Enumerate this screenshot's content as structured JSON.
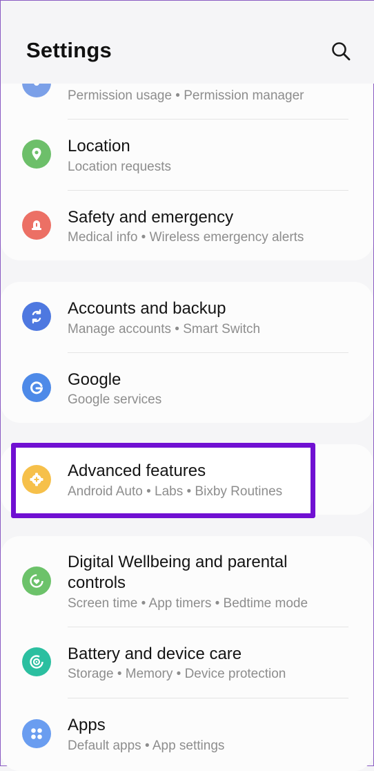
{
  "header": {
    "title": "Settings"
  },
  "colors": {
    "highlight": "#7010d2",
    "privacy": "#7ba0e8",
    "location": "#6dbf6a",
    "safety": "#ec7065",
    "accounts": "#4e78e0",
    "google": "#4e8ae8",
    "advanced": "#f6c04a",
    "wellbeing": "#6cc26a",
    "battery": "#2bbfa0",
    "apps": "#6a9df0"
  },
  "rows": {
    "privacy": {
      "subtitle": "Permission usage  •  Permission manager",
      "icon": "shield-icon"
    },
    "location": {
      "title": "Location",
      "subtitle": "Location requests",
      "icon": "location-pin-icon"
    },
    "safety": {
      "title": "Safety and emergency",
      "subtitle": "Medical info  •  Wireless emergency alerts",
      "icon": "siren-icon"
    },
    "accounts": {
      "title": "Accounts and backup",
      "subtitle": "Manage accounts  •  Smart Switch",
      "icon": "sync-icon"
    },
    "google": {
      "title": "Google",
      "subtitle": "Google services",
      "icon": "google-icon"
    },
    "advanced": {
      "title": "Advanced features",
      "subtitle": "Android Auto  •  Labs  •  Bixby Routines",
      "icon": "gear-plus-icon"
    },
    "wellbeing": {
      "title_line1": "Digital Wellbeing and parental",
      "title_line2": "controls",
      "subtitle": "Screen time  •  App timers  •  Bedtime mode",
      "icon": "wellbeing-icon"
    },
    "battery": {
      "title": "Battery and device care",
      "subtitle": "Storage  •  Memory  •  Device protection",
      "icon": "device-care-icon"
    },
    "apps": {
      "title": "Apps",
      "subtitle": "Default apps  •  App settings",
      "icon": "apps-grid-icon"
    }
  }
}
